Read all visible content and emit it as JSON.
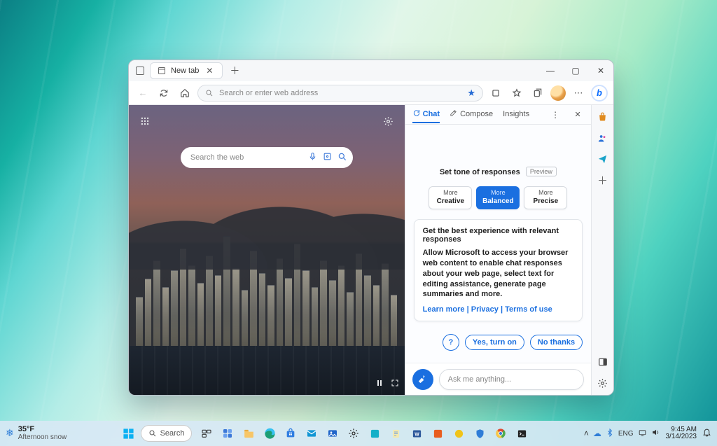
{
  "taskbar": {
    "weather": {
      "temp": "35°F",
      "condition": "Afternoon snow"
    },
    "search_label": "Search",
    "tray": {
      "lang": "ENG",
      "time": "9:45 AM",
      "date": "3/14/2023"
    }
  },
  "edge": {
    "tab_title": "New tab",
    "address_placeholder": "Search or enter web address",
    "ntp": {
      "search_placeholder": "Search the web"
    },
    "chat": {
      "tabs": {
        "chat": "Chat",
        "compose": "Compose",
        "insights": "Insights"
      },
      "tone_heading": "Set tone of responses",
      "preview_badge": "Preview",
      "tone": {
        "more": "More",
        "creative": "Creative",
        "balanced": "Balanced",
        "precise": "Precise"
      },
      "card": {
        "title": "Get the best experience with relevant responses",
        "body": "Allow Microsoft to access your browser web content to enable chat responses about your web page, select text for editing assistance, generate page summaries and more.",
        "learn_more": "Learn more",
        "privacy": "Privacy",
        "terms": "Terms of use"
      },
      "actions": {
        "yes": "Yes, turn on",
        "no": "No thanks"
      },
      "input_placeholder": "Ask me anything..."
    }
  }
}
